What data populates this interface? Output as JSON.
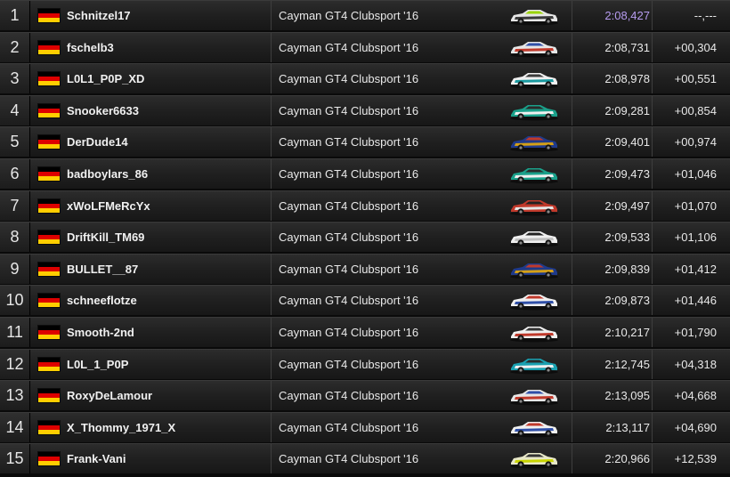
{
  "flag_colors": {
    "black": "#000000",
    "red": "#dd0000",
    "gold": "#ffce00"
  },
  "best_time_color": "#b79cf0",
  "rows": [
    {
      "position": "1",
      "driver": "Schnitzel17",
      "car": "Cayman GT4 Clubsport '16",
      "livery": [
        "#e6e6e6",
        "#3a3a3a",
        "#9ad400"
      ],
      "time": "2:08,427",
      "gap": "--,---",
      "best": true
    },
    {
      "position": "2",
      "driver": "fschelb3",
      "car": "Cayman GT4 Clubsport '16",
      "livery": [
        "#e6e6e6",
        "#c0392b",
        "#2f4fa8"
      ],
      "time": "2:08,731",
      "gap": "+00,304",
      "best": false
    },
    {
      "position": "3",
      "driver": "L0L1_P0P_XD",
      "car": "Cayman GT4 Clubsport '16",
      "livery": [
        "#f0f0f0",
        "#1a9aa0",
        "#3b3b3b"
      ],
      "time": "2:08,978",
      "gap": "+00,551",
      "best": false
    },
    {
      "position": "4",
      "driver": "Snooker6633",
      "car": "Cayman GT4 Clubsport '16",
      "livery": [
        "#1aa08a",
        "#f0f0f0",
        "#2b2b2b"
      ],
      "time": "2:09,281",
      "gap": "+00,854",
      "best": false
    },
    {
      "position": "5",
      "driver": "DerDude14",
      "car": "Cayman GT4 Clubsport '16",
      "livery": [
        "#1f3a8a",
        "#d4a017",
        "#c0392b"
      ],
      "time": "2:09,401",
      "gap": "+00,974",
      "best": false
    },
    {
      "position": "6",
      "driver": "badboylars_86",
      "car": "Cayman GT4 Clubsport '16",
      "livery": [
        "#1aa08a",
        "#f0f0f0",
        "#2b2b2b"
      ],
      "time": "2:09,473",
      "gap": "+01,046",
      "best": false
    },
    {
      "position": "7",
      "driver": "xWoLFMeRcYx",
      "car": "Cayman GT4 Clubsport '16",
      "livery": [
        "#c0392b",
        "#e6e6e6",
        "#222222"
      ],
      "time": "2:09,497",
      "gap": "+01,070",
      "best": false
    },
    {
      "position": "8",
      "driver": "DriftKill_TM69",
      "car": "Cayman GT4 Clubsport '16",
      "livery": [
        "#f0f0f0",
        "#c0c0c0",
        "#222222"
      ],
      "time": "2:09,533",
      "gap": "+01,106",
      "best": false
    },
    {
      "position": "9",
      "driver": "BULLET__87",
      "car": "Cayman GT4 Clubsport '16",
      "livery": [
        "#1f3a8a",
        "#d4a017",
        "#c0392b"
      ],
      "time": "2:09,839",
      "gap": "+01,412",
      "best": false
    },
    {
      "position": "10",
      "driver": "schneeflotze",
      "car": "Cayman GT4 Clubsport '16",
      "livery": [
        "#f0f0f0",
        "#2f4fa8",
        "#c0392b"
      ],
      "time": "2:09,873",
      "gap": "+01,446",
      "best": false
    },
    {
      "position": "11",
      "driver": "Smooth-2nd",
      "car": "Cayman GT4 Clubsport '16",
      "livery": [
        "#f0f0f0",
        "#c0392b",
        "#333333"
      ],
      "time": "2:10,217",
      "gap": "+01,790",
      "best": false
    },
    {
      "position": "12",
      "driver": "L0L_1_P0P",
      "car": "Cayman GT4 Clubsport '16",
      "livery": [
        "#1aa0b0",
        "#f0f0f0",
        "#2b2b2b"
      ],
      "time": "2:12,745",
      "gap": "+04,318",
      "best": false
    },
    {
      "position": "13",
      "driver": "RoxyDeLamour",
      "car": "Cayman GT4 Clubsport '16",
      "livery": [
        "#e6e6e6",
        "#c0392b",
        "#2f4fa8"
      ],
      "time": "2:13,095",
      "gap": "+04,668",
      "best": false
    },
    {
      "position": "14",
      "driver": "X_Thommy_1971_X",
      "car": "Cayman GT4 Clubsport '16",
      "livery": [
        "#f0f0f0",
        "#2f4fa8",
        "#c0392b"
      ],
      "time": "2:13,117",
      "gap": "+04,690",
      "best": false
    },
    {
      "position": "15",
      "driver": "Frank-Vani",
      "car": "Cayman GT4 Clubsport '16",
      "livery": [
        "#e8e8c8",
        "#c8d400",
        "#333333"
      ],
      "time": "2:20,966",
      "gap": "+12,539",
      "best": false
    }
  ]
}
